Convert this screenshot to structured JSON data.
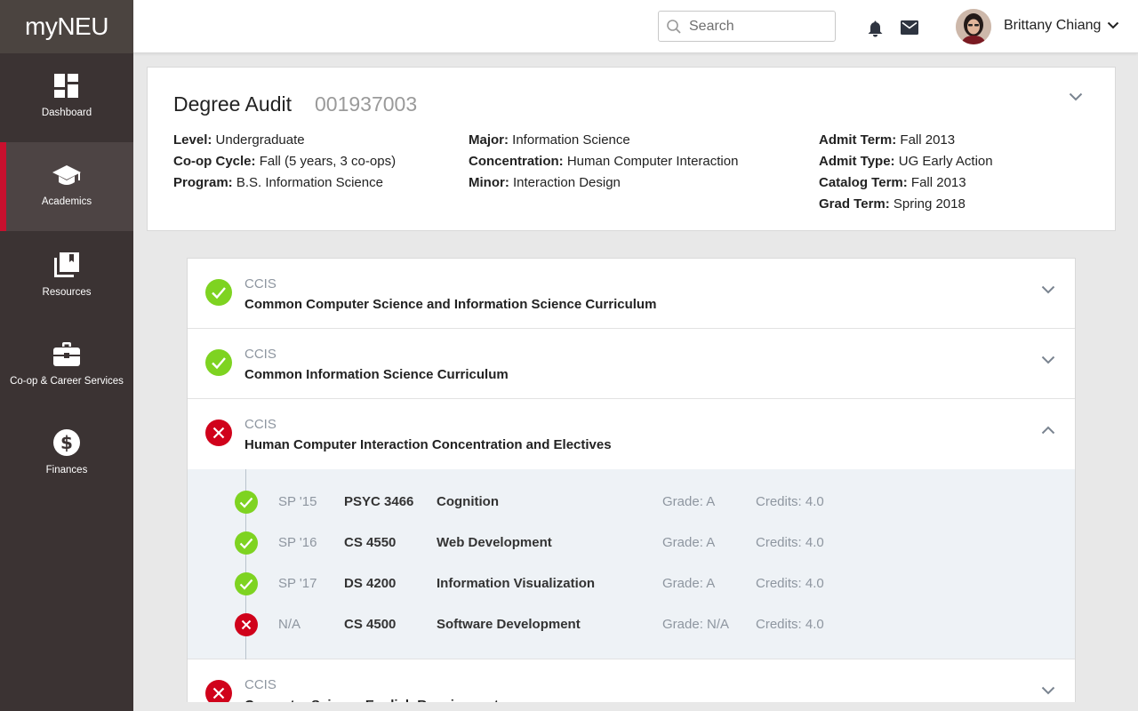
{
  "app": {
    "brand": "myNEU"
  },
  "sidebar": {
    "items": [
      {
        "label": "Dashboard",
        "icon": "dashboard-icon",
        "active": false
      },
      {
        "label": "Academics",
        "icon": "graduation-cap-icon",
        "active": true
      },
      {
        "label": "Resources",
        "icon": "books-icon",
        "active": false
      },
      {
        "label": "Co-op & Career Services",
        "icon": "briefcase-icon",
        "active": false
      },
      {
        "label": "Finances",
        "icon": "dollar-icon",
        "active": false
      }
    ]
  },
  "header": {
    "search": {
      "placeholder": "Search",
      "value": ""
    },
    "user": {
      "name": "Brittany Chiang"
    }
  },
  "audit": {
    "title": "Degree Audit",
    "student_id": "001937003",
    "level_label": "Level:",
    "level": "Undergraduate",
    "coop_label": "Co-op Cycle:",
    "coop": "Fall (5 years, 3 co-ops)",
    "program_label": "Program:",
    "program": "B.S. Information Science",
    "major_label": "Major:",
    "major": "Information Science",
    "concentration_label": "Concentration:",
    "concentration": "Human Computer Interaction",
    "minor_label": "Minor:",
    "minor": "Interaction Design",
    "admit_term_label": "Admit Term:",
    "admit_term": "Fall 2013",
    "admit_type_label": "Admit Type:",
    "admit_type": "UG Early Action",
    "catalog_term_label": "Catalog Term:",
    "catalog_term": "Fall 2013",
    "grad_term_label": "Grad Term:",
    "grad_term": "Spring 2018"
  },
  "requirements": [
    {
      "college": "CCIS",
      "title": "Common Computer Science and Information Science Curriculum",
      "status": "complete",
      "expanded": false
    },
    {
      "college": "CCIS",
      "title": "Common Information Science Curriculum",
      "status": "complete",
      "expanded": false
    },
    {
      "college": "CCIS",
      "title": "Human Computer Interaction Concentration and Electives",
      "status": "incomplete",
      "expanded": true
    },
    {
      "college": "CCIS",
      "title": "Computer Science English Requirement",
      "status": "incomplete",
      "expanded": false
    }
  ],
  "courses": [
    {
      "term": "SP '15",
      "code": "PSYC 3466",
      "name": "Cognition",
      "grade": "Grade: A",
      "credits": "Credits: 4.0",
      "status": "complete"
    },
    {
      "term": "SP '16",
      "code": "CS 4550",
      "name": "Web Development",
      "grade": "Grade: A",
      "credits": "Credits: 4.0",
      "status": "complete"
    },
    {
      "term": "SP '17",
      "code": "DS 4200",
      "name": "Information Visualization",
      "grade": "Grade: A",
      "credits": "Credits: 4.0",
      "status": "complete"
    },
    {
      "term": "N/A",
      "code": "CS 4500",
      "name": "Software Development",
      "grade": "Grade: N/A",
      "credits": "Credits: 4.0",
      "status": "incomplete"
    }
  ],
  "colors": {
    "sidebar_bg": "#3b3333",
    "brand_bg": "#4b4440",
    "active_accent": "#c8102e",
    "complete_green": "#7ed321",
    "incomplete_red": "#d0021b",
    "muted_text": "#8e96a0"
  }
}
